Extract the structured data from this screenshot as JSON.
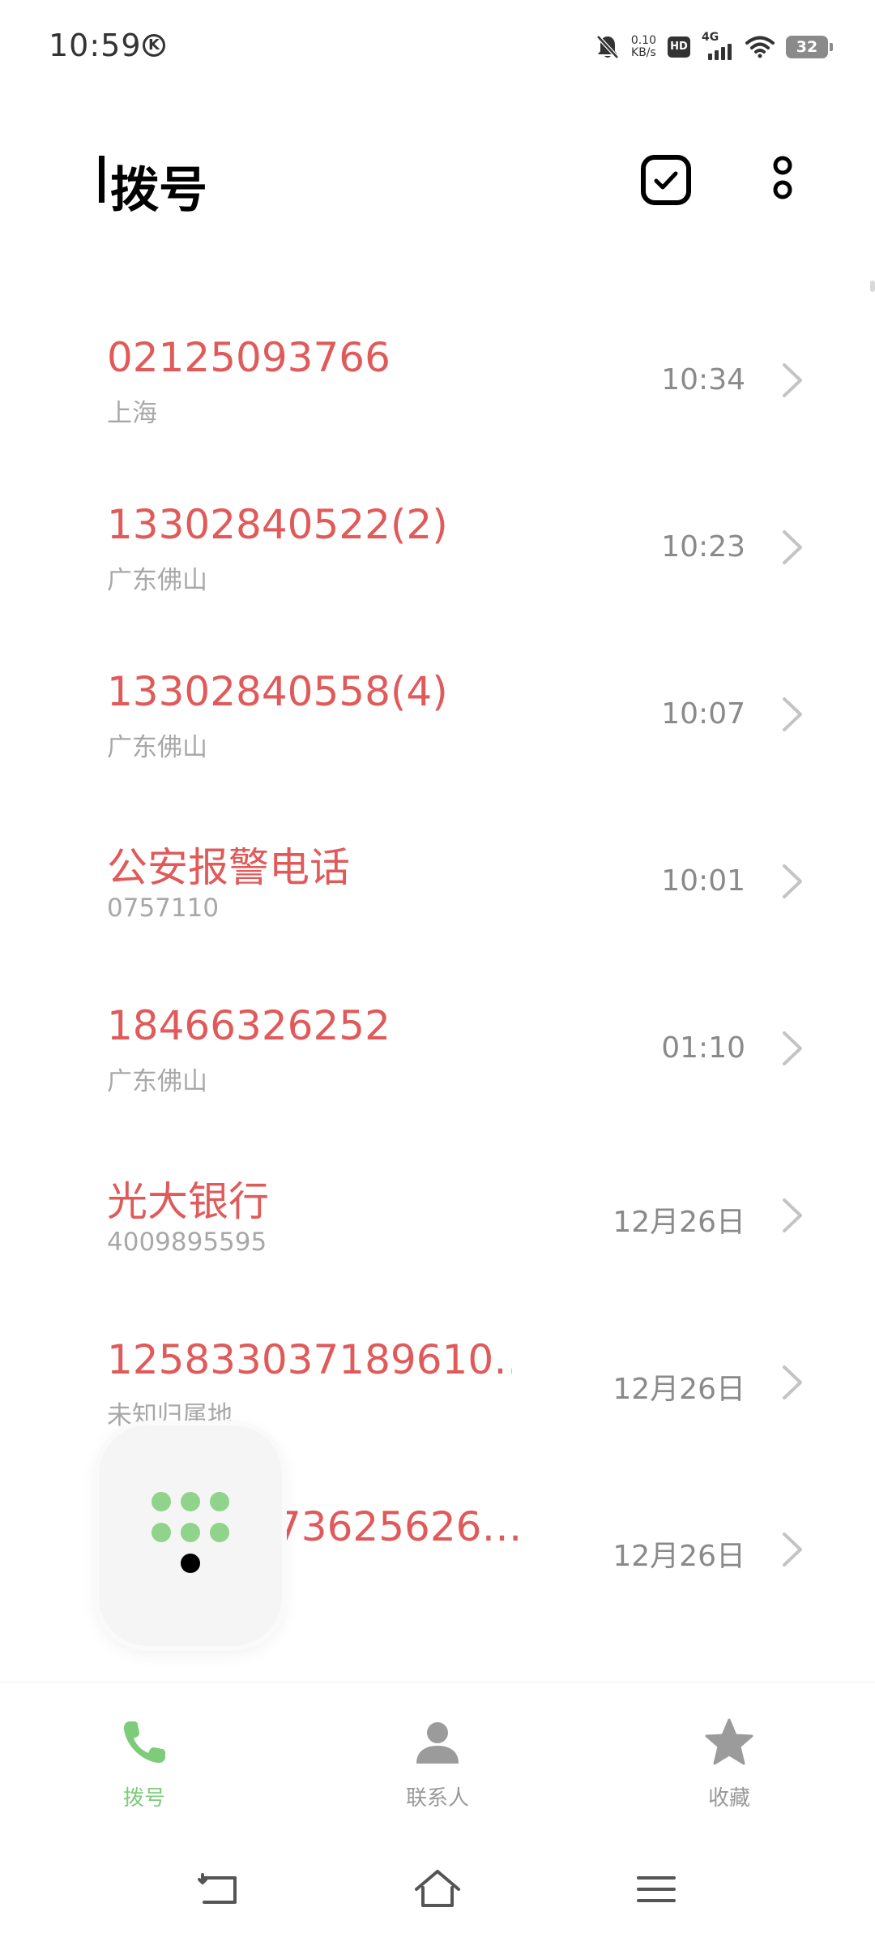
{
  "status_bar": {
    "time": "10:59",
    "k_badge": "K",
    "net_speed_value": "0.10",
    "net_speed_unit": "KB/s",
    "hd_label": "HD",
    "network_label": "4G",
    "battery_level": "32",
    "icons": [
      "k-circle-icon",
      "bell-muted-icon",
      "hd-icon",
      "signal-4g-icon",
      "wifi-icon",
      "battery-icon"
    ]
  },
  "header": {
    "title": "拨号",
    "select_icon": "checkbox-icon",
    "more_icon": "more-vertical-icon"
  },
  "calls": [
    {
      "name": "02125093766",
      "sub": "上海",
      "time": "10:34"
    },
    {
      "name": "13302840522(2)",
      "sub": "广东佛山",
      "time": "10:23"
    },
    {
      "name": "13302840558(4)",
      "sub": "广东佛山",
      "time": "10:07"
    },
    {
      "name": "公安报警电话",
      "sub": "0757110",
      "time": "10:01"
    },
    {
      "name": "18466326252",
      "sub": "广东佛山",
      "time": "01:10"
    },
    {
      "name": "光大银行",
      "sub": "4009895595",
      "time": "12月26日"
    },
    {
      "name": "125833037189610…",
      "sub": "未知归属地",
      "time": "12月26日"
    },
    {
      "name": "73625626…",
      "sub": "",
      "time": "12月26日"
    }
  ],
  "nav": {
    "items": [
      {
        "label": "拨号",
        "icon": "phone-icon",
        "active": true
      },
      {
        "label": "联系人",
        "icon": "contact-person-icon",
        "active": false
      },
      {
        "label": "收藏",
        "icon": "star-icon",
        "active": false
      }
    ]
  },
  "colors": {
    "missed_call": "#e05a5a",
    "accent_green": "#7ccc7a",
    "muted_text": "#a8a8a8",
    "icon_gray": "#9b9b9b"
  }
}
